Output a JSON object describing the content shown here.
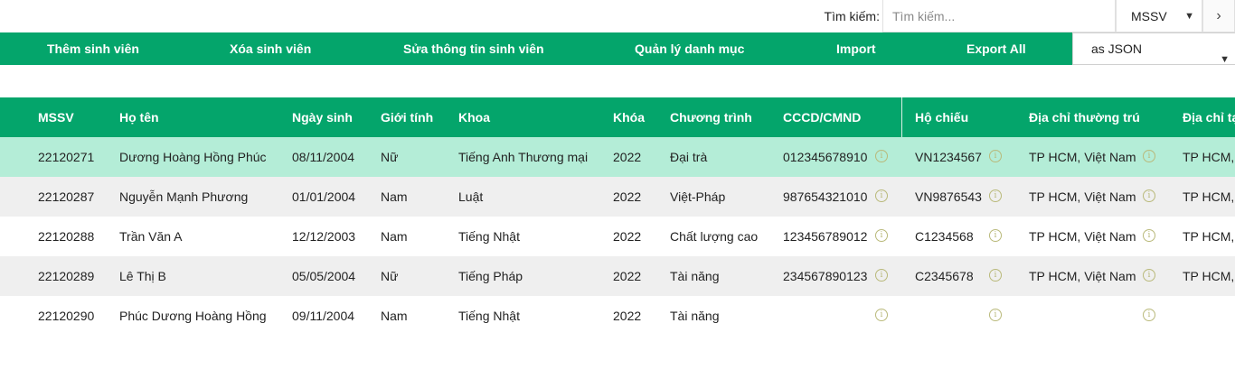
{
  "search": {
    "label": "Tìm kiếm:",
    "placeholder": "Tìm kiếm...",
    "field": "MSSV",
    "next": "›"
  },
  "nav": {
    "items": [
      "Thêm sinh viên",
      "Xóa sinh viên",
      "Sửa thông tin sinh viên",
      "Quản lý danh mục",
      "Import",
      "Export All"
    ],
    "export_format": "as JSON"
  },
  "table": {
    "headers": [
      "MSSV",
      "Họ tên",
      "Ngày sinh",
      "Giới tính",
      "Khoa",
      "Khóa",
      "Chương trình",
      "CCCD/CMND",
      "Hộ chiếu",
      "Địa chỉ thường trú",
      "Địa chỉ tạ"
    ],
    "rows": [
      [
        "22120271",
        "Dương Hoàng Hồng Phúc",
        "08/11/2004",
        "Nữ",
        "Tiếng Anh Thương mại",
        "2022",
        "Đại trà",
        "012345678910",
        "VN1234567",
        "TP HCM, Việt Nam",
        "TP HCM,"
      ],
      [
        "22120287",
        "Nguyễn Mạnh Phương",
        "01/01/2004",
        "Nam",
        "Luật",
        "2022",
        "Việt-Pháp",
        "987654321010",
        "VN9876543",
        "TP HCM, Việt Nam",
        "TP HCM,"
      ],
      [
        "22120288",
        "Trần Văn A",
        "12/12/2003",
        "Nam",
        "Tiếng Nhật",
        "2022",
        "Chất lượng cao",
        "123456789012",
        "C1234568",
        "TP HCM, Việt Nam",
        "TP HCM,"
      ],
      [
        "22120289",
        "Lê Thị B",
        "05/05/2004",
        "Nữ",
        "Tiếng Pháp",
        "2022",
        "Tài năng",
        "234567890123",
        "C2345678",
        "TP HCM, Việt Nam",
        "TP HCM,"
      ],
      [
        "22120290",
        "Phúc Dương Hoàng Hồng",
        "09/11/2004",
        "Nam",
        "Tiếng Nhật",
        "2022",
        "Tài năng",
        "",
        "",
        "",
        ""
      ]
    ],
    "info_icon": "info-circle-icon",
    "highlight_row": 0
  },
  "colors": {
    "accent": "#04a56b",
    "highlight": "#b4edd7",
    "alt_row": "#efefef"
  }
}
